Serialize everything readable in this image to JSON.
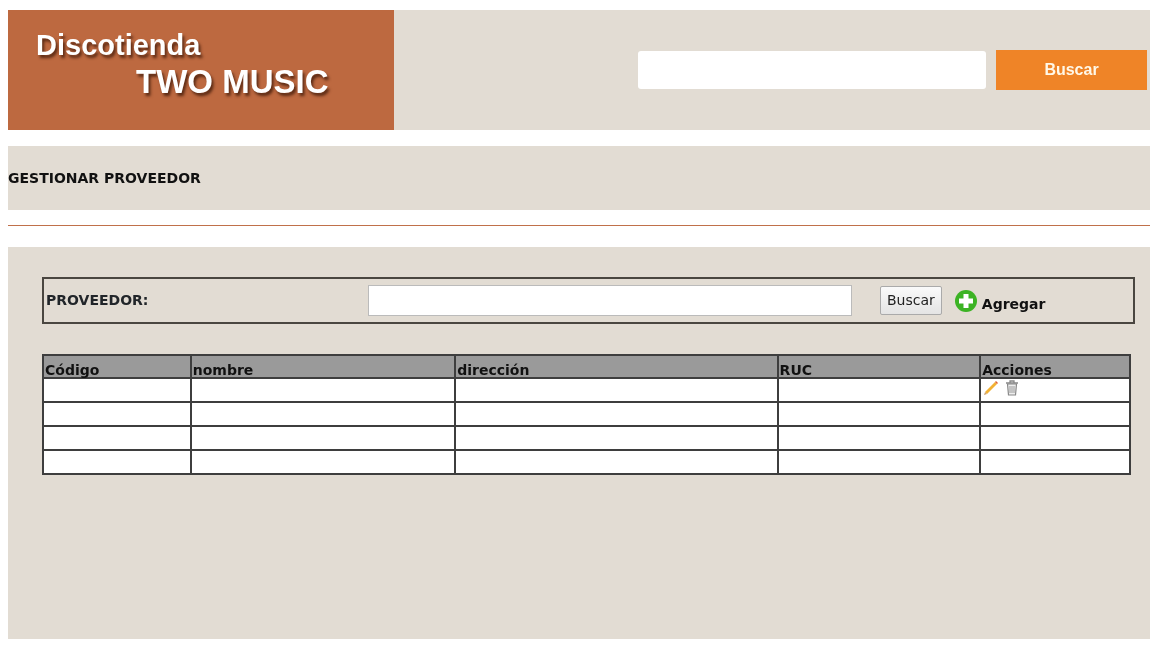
{
  "header": {
    "logo_lines": [
      "Discotienda",
      "TWO MUSIC"
    ],
    "search_button": "Buscar"
  },
  "page_title": "GESTIONAR PROVEEDOR",
  "filter": {
    "label": "PROVEEDOR:",
    "search_button": "Buscar",
    "add_link": "Agregar"
  },
  "table": {
    "columns": [
      "Código",
      "nombre",
      "dirección",
      "RUC",
      "Acciones"
    ],
    "rows": [
      {
        "show_actions": true
      },
      {
        "show_actions": false
      },
      {
        "show_actions": false
      },
      {
        "show_actions": false
      }
    ]
  }
}
